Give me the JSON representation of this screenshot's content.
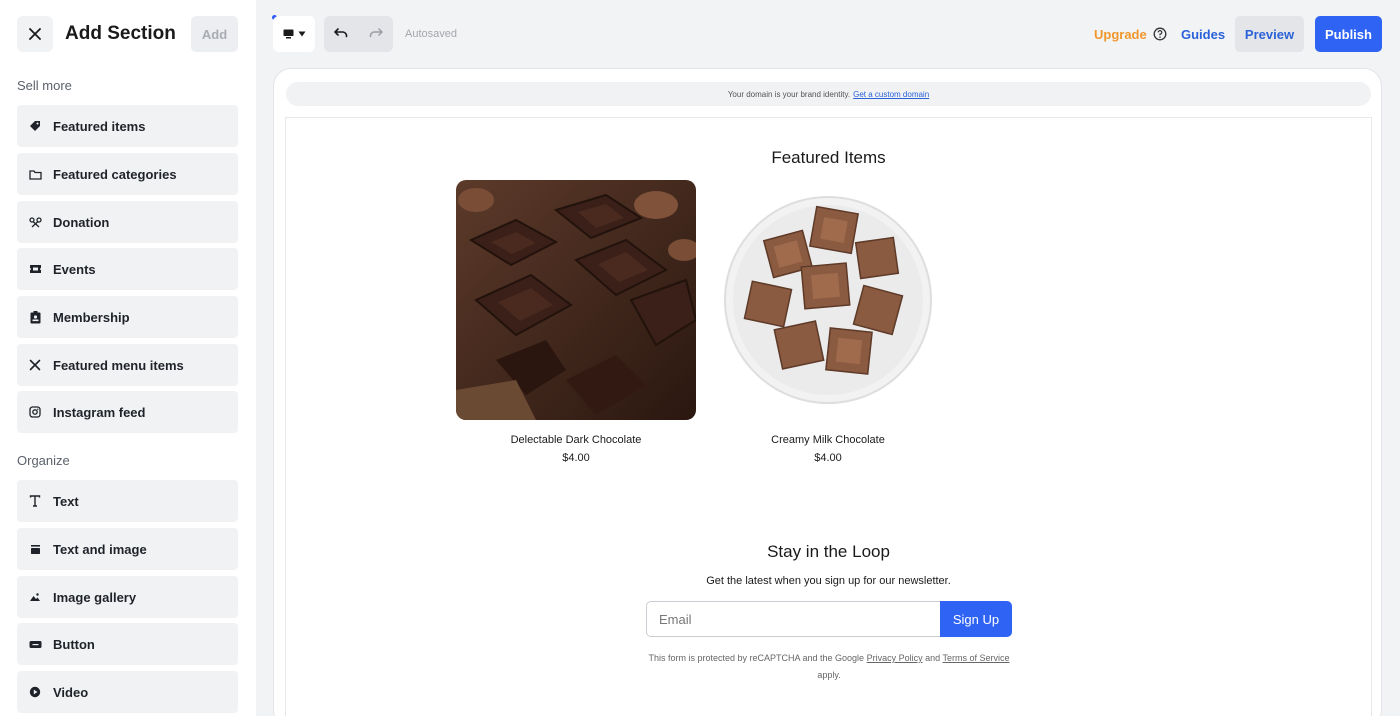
{
  "sidebar": {
    "title": "Add Section",
    "add_label": "Add",
    "groups": [
      {
        "label": "Sell more",
        "items": [
          {
            "label": "Featured items",
            "icon": "tag-icon"
          },
          {
            "label": "Featured categories",
            "icon": "folder-icon"
          },
          {
            "label": "Donation",
            "icon": "ribbon-icon"
          },
          {
            "label": "Events",
            "icon": "ticket-icon"
          },
          {
            "label": "Membership",
            "icon": "badge-icon"
          },
          {
            "label": "Featured menu items",
            "icon": "utensils-icon"
          },
          {
            "label": "Instagram feed",
            "icon": "instagram-icon"
          }
        ]
      },
      {
        "label": "Organize",
        "items": [
          {
            "label": "Text",
            "icon": "text-icon"
          },
          {
            "label": "Text and image",
            "icon": "text-image-icon"
          },
          {
            "label": "Image gallery",
            "icon": "gallery-icon"
          },
          {
            "label": "Button",
            "icon": "button-icon"
          },
          {
            "label": "Video",
            "icon": "play-icon"
          }
        ]
      }
    ]
  },
  "toolbar": {
    "autosaved": "Autosaved",
    "upgrade": "Upgrade",
    "guides": "Guides",
    "preview": "Preview",
    "publish": "Publish"
  },
  "banner": {
    "text": "Your domain is your brand identity.",
    "link": "Get a custom domain"
  },
  "featured": {
    "title": "Featured Items",
    "products": [
      {
        "name": "Delectable Dark Chocolate",
        "price": "$4.00"
      },
      {
        "name": "Creamy Milk Chocolate",
        "price": "$4.00"
      }
    ]
  },
  "newsletter": {
    "title": "Stay in the Loop",
    "subtitle": "Get the latest when you sign up for our newsletter.",
    "email_placeholder": "Email",
    "signup_label": "Sign Up",
    "recaptcha_prefix": "This form is protected by reCAPTCHA and the Google",
    "privacy": "Privacy Policy",
    "and": "and",
    "terms": "Terms of Service",
    "suffix": "apply."
  },
  "colors": {
    "accent": "#2e63f4",
    "upgrade": "#f0972c",
    "link": "#2b62d8"
  }
}
